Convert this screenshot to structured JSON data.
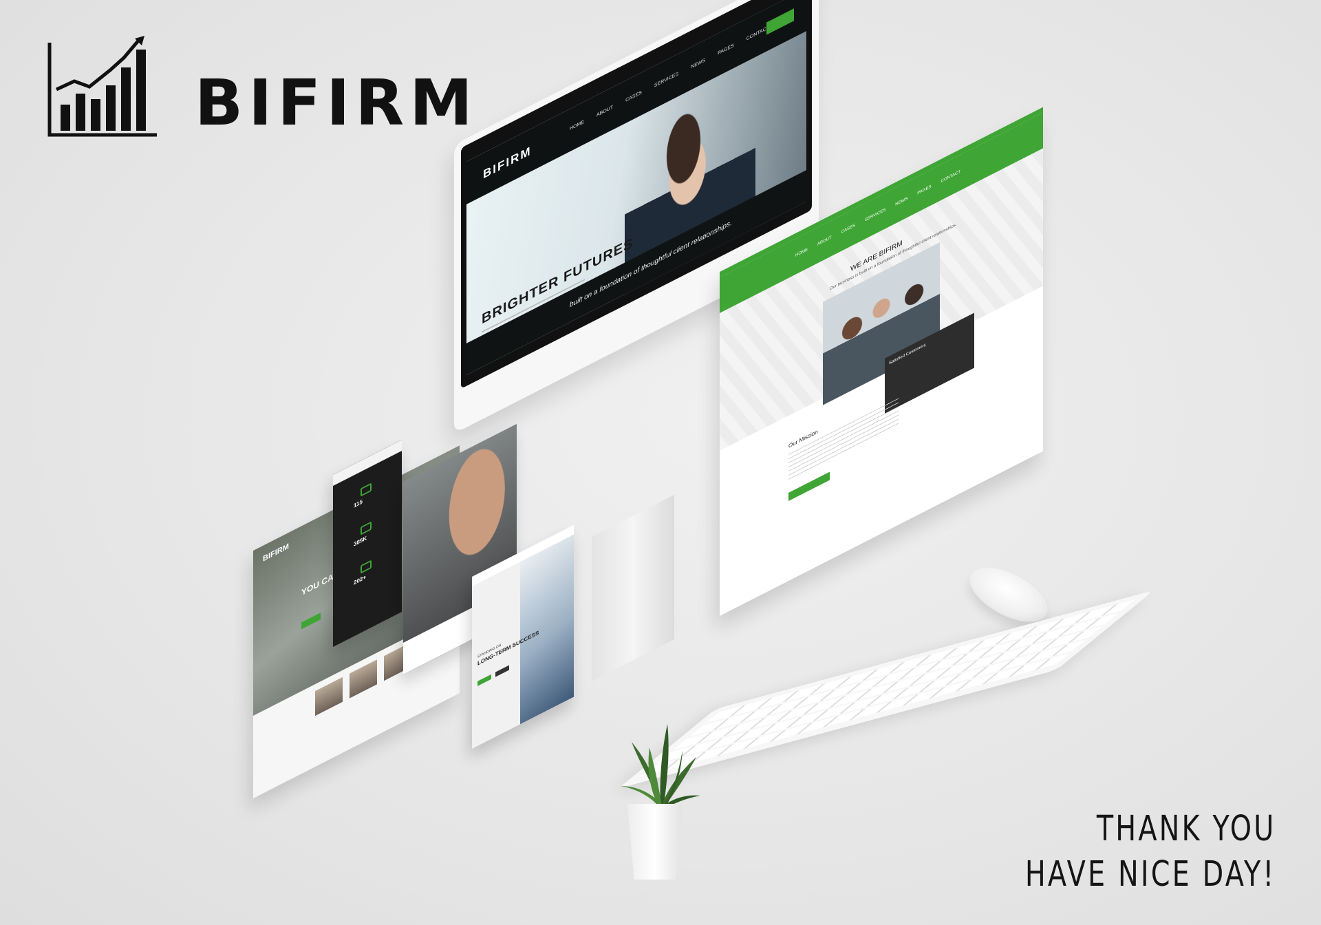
{
  "brand": {
    "name": "BIFIRM",
    "icon": "bar-chart-growth-icon",
    "accent_color": "#3fa535",
    "dark_color": "#111111"
  },
  "closing": {
    "line1": "THANK YOU",
    "line2": "HAVE NICE DAY!"
  },
  "mockups": {
    "monitor": {
      "brand": "BIFIRM",
      "nav_items": [
        "HOME",
        "ABOUT",
        "CASES",
        "SERVICES",
        "NEWS",
        "PAGES",
        "CONTACT"
      ],
      "hero_title": "BRIGHTER FUTURES",
      "band_text": "built on a foundation of thoughtful client relationships."
    },
    "right_page": {
      "title": "WE ARE BIFIRM",
      "subtitle": "Our business is built on a foundation of thoughtful client relationships.",
      "mission_title": "Our Mission",
      "dark_box_title": "Satisfied Customers",
      "nav_items": [
        "HOME",
        "ABOUT",
        "CASES",
        "SERVICES",
        "NEWS",
        "PAGES",
        "CONTACT"
      ]
    },
    "left_page": {
      "brand": "BIFIRM",
      "hero_title": "YOU CAN"
    },
    "stats_page": {
      "stats": [
        "115",
        "385K",
        "202+"
      ]
    },
    "success_page": {
      "kicker": "STANDING ON",
      "title": "LONG-TERM SUCCESS"
    }
  }
}
